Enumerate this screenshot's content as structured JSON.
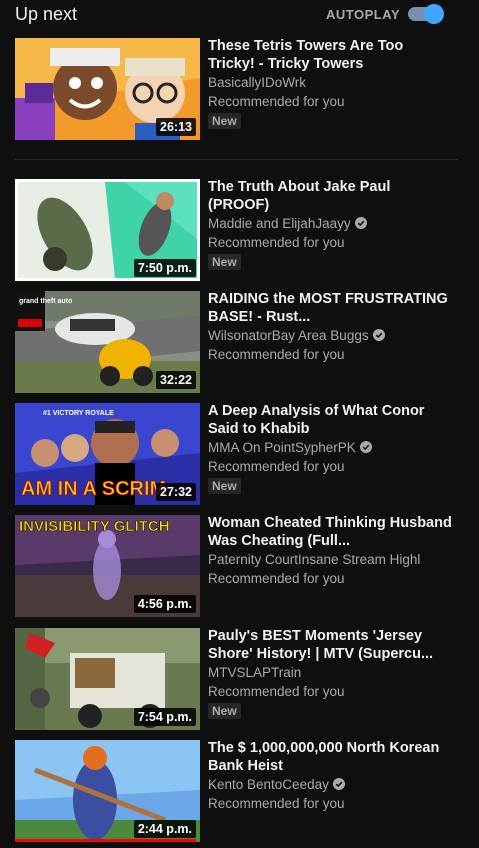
{
  "header": {
    "title": "Up next",
    "autoplay_label": "AUTOPLAY",
    "autoplay_on": true,
    "accent_color": "#3ea6ff"
  },
  "videos": [
    {
      "title": "These Tetris Towers Are Too Tricky! - Tricky Towers",
      "channel": "BasicallyIDoWrk",
      "verified": false,
      "recommended": "Recommended for you",
      "badge": "New",
      "duration": "26:13"
    },
    {
      "title": "The Truth About Jake Paul (PROOF)",
      "channel": "Maddie and ElijahJaayy",
      "verified": true,
      "recommended": "Recommended for you",
      "badge": "New",
      "duration": "7:50 p.m."
    },
    {
      "title": "RAIDING the MOST FRUSTRATING BASE! - Rust...",
      "channel": "WilsonatorBay Area Buggs",
      "verified": true,
      "recommended": "Recommended for you",
      "badge": "",
      "duration": "32:22"
    },
    {
      "title": "A Deep Analysis of What Conor Said to Khabib",
      "channel": "MMA On PointSypherPK",
      "verified": true,
      "recommended": "Recommended for you",
      "badge": "New",
      "duration": "27:32"
    },
    {
      "title": "Woman Cheated Thinking Husband Was Cheating (Full...",
      "channel": "Paternity CourtInsane Stream Highl",
      "verified": false,
      "recommended": "Recommended for you",
      "badge": "",
      "duration": "4:56 p.m."
    },
    {
      "title": "Pauly's BEST Moments 'Jersey Shore' History! | MTV (Supercu...",
      "channel": "MTVSLAPTrain",
      "verified": false,
      "recommended": "Recommended for you",
      "badge": "New",
      "duration": "7:54 p.m."
    },
    {
      "title": "The $ 1,000,000,000 North Korean Bank Heist",
      "channel": "Kento BentoCeeday",
      "verified": true,
      "recommended": "Recommended for you",
      "badge": "",
      "duration": "2:44 p.m.",
      "watched_fraction": 0.98
    }
  ],
  "thumbnail_text": {
    "gta_logo": "grand theft auto",
    "victory_royale": "#1 VICTORY ROYALE",
    "scrim_caption": "AM IN A SCRIM",
    "invisibility_caption": "INVISIBILITY GLITCH"
  }
}
